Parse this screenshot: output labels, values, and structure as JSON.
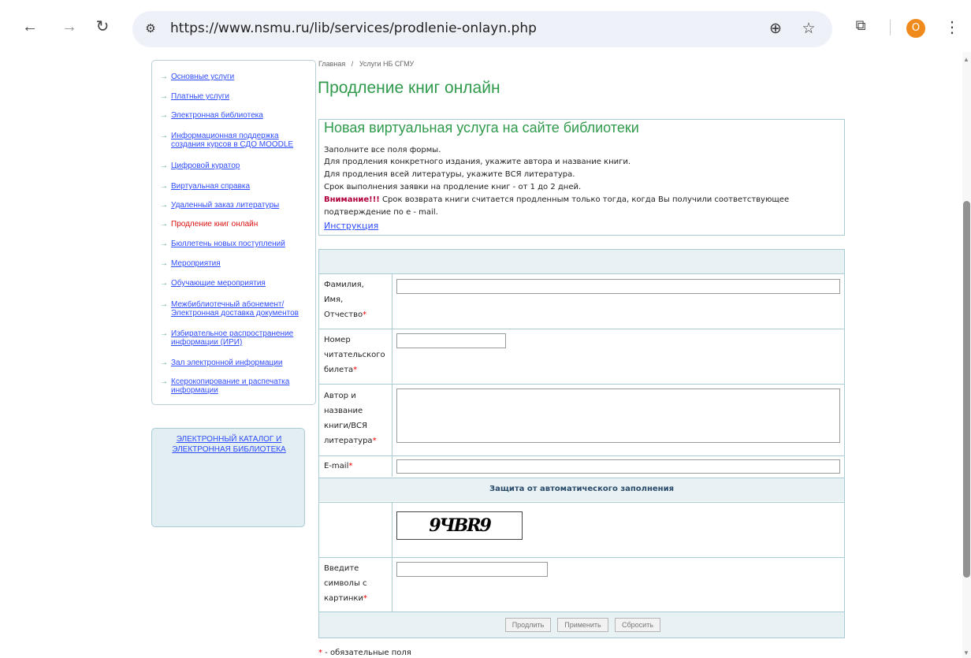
{
  "browser": {
    "url": "https://www.nsmu.ru/lib/services/prodlenie-onlayn.php",
    "profile_initial": "O",
    "icons": [
      "back-icon",
      "forward-icon",
      "reload-icon",
      "site-info-icon",
      "zoom-icon",
      "bookmark-star-icon",
      "extensions-icon",
      "menu-icon"
    ]
  },
  "sidebar": {
    "items": [
      {
        "label": "Основные услуги",
        "active": false
      },
      {
        "label": "Платные услуги",
        "active": false
      },
      {
        "label": "Электронная библиотека",
        "active": false
      },
      {
        "label": "Информационная поддержка создания курсов в СДО MOODLE",
        "active": false
      },
      {
        "label": "Цифровой куратор",
        "active": false
      },
      {
        "label": "Виртуальная справка",
        "active": false
      },
      {
        "label": "Удаленный заказ литературы",
        "active": false
      },
      {
        "label": "Продление книг онлайн",
        "active": true
      },
      {
        "label": "Бюллетень новых поступлений",
        "active": false
      },
      {
        "label": "Мероприятия",
        "active": false
      },
      {
        "label": "Обучающие мероприятия",
        "active": false
      },
      {
        "label": "Межбиблиотечный абонемент/ Электронная доставка документов",
        "active": false
      },
      {
        "label": "Избирательное распространение информации (ИРИ)",
        "active": false
      },
      {
        "label": "Зал электронной информации",
        "active": false
      },
      {
        "label": "Ксерокопирование и распечатка информации",
        "active": false
      }
    ],
    "catalog_links": [
      "ЭЛЕКТРОННЫЙ КАТАЛОГ И",
      "ЭЛЕКТРОННАЯ БИБЛИОТЕКА"
    ]
  },
  "breadcrumb": {
    "home": "Главная",
    "separator": "/",
    "current": "Услуги НБ СГМУ"
  },
  "page_title": "Продление книг онлайн",
  "info": {
    "heading": "Новая виртуальная услуга на сайте библиотеки",
    "lines": [
      "Заполните все поля формы.",
      "Для продления конкретного издания, укажите автора и название книги.",
      "Для продления всей литературы, укажите ВСЯ литература.",
      "Срок выполнения заявки на продление книг - от 1 до 2 дней."
    ],
    "warning_label": "Внимание!!!",
    "warning_text": " Срок возврата книги считается продленным только тогда, когда Вы получили соответствующее",
    "warning_text_2": "подтверждение по e - mail.",
    "instruction_link": "Инструкция"
  },
  "form": {
    "fullname_label": [
      "Фамилия,",
      "Имя,",
      "Отчество"
    ],
    "card_label": [
      "Номер",
      "читательского",
      "билета"
    ],
    "book_label": [
      "Автор и",
      "название",
      "книги/ВСЯ",
      "литература"
    ],
    "email_label": "E-mail",
    "required_mark": "*",
    "protection_title": "Защита от автоматического заполнения",
    "captcha_text": "9ЧВR9",
    "captcha_label": [
      "Введите",
      "символы с",
      "картинки"
    ],
    "buttons": {
      "submit": "Продлить",
      "apply": "Применить",
      "reset": "Сбросить"
    }
  },
  "footnote": {
    "star": "*",
    "text": " - обязательные поля"
  }
}
